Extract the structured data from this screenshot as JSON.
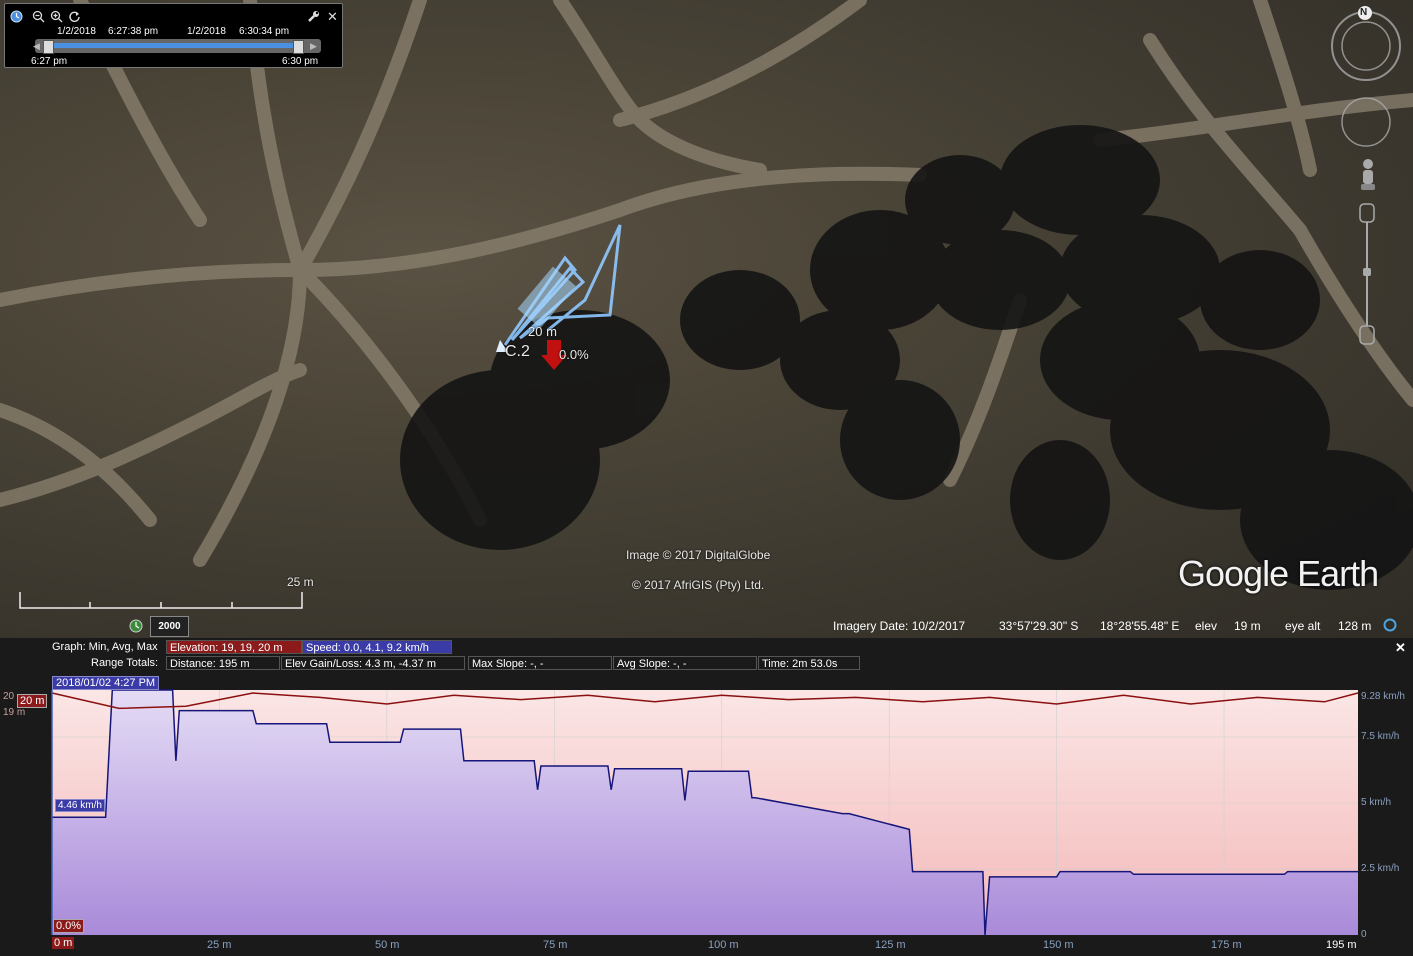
{
  "time_slider": {
    "start_date": "1/2/2018",
    "start_time": "6:27:38 pm",
    "end_date": "1/2/2018",
    "end_time": "6:30:34 pm",
    "left_label": "6:27 pm",
    "right_label": "6:30 pm",
    "close_glyph": "✕"
  },
  "map": {
    "scale_label": "25 m",
    "year_badge": "2000",
    "track_label_distance": "20 m",
    "track_label_name": "C.2",
    "track_label_grade": "0.0%",
    "copyright_image": "Image © 2017 DigitalGlobe",
    "copyright_afrigis": "© 2017 AfriGIS (Pty) Ltd.",
    "logo": "Google Earth",
    "north": "N"
  },
  "status_bar": {
    "imagery_date": "Imagery Date: 10/2/2017",
    "latitude": "33°57'29.30\" S",
    "longitude": "18°28'55.48\" E",
    "elev_label": "elev",
    "elev_value": "19 m",
    "eye_alt_label": "eye alt",
    "eye_alt_value": "128 m"
  },
  "profile": {
    "graph_label": "Graph: Min, Avg, Max",
    "range_label": "Range Totals:",
    "elevation_summary": "Elevation: 19, 19, 20 m",
    "speed_summary": "Speed: 0.0, 4.1, 9.2 km/h",
    "distance": "Distance: 195 m",
    "elev_gain_loss": "Elev Gain/Loss: 4.3 m, -4.37 m",
    "max_slope": "Max Slope: -, -",
    "avg_slope": "Avg Slope: -, -",
    "time": "Time: 2m 53.0s",
    "close_glyph": "✕",
    "cursor_time": "2018/01/02 4:27 PM",
    "cursor_elev": "20 m",
    "cursor_speed": "4.46 km/h",
    "cursor_grade": "0.0%",
    "cursor_distance": "0 m",
    "left_axis": [
      "20",
      "19 m"
    ],
    "right_axis": [
      "9.28 km/h",
      "7.5 km/h",
      "5 km/h",
      "2.5 km/h",
      "0"
    ],
    "x_ticks": [
      "25 m",
      "50 m",
      "75 m",
      "100 m",
      "125 m",
      "150 m",
      "175 m",
      "195 m"
    ]
  },
  "chart_data": {
    "type": "line",
    "xlabel": "",
    "ylabel": "",
    "xlim": [
      0,
      195
    ],
    "series": [
      {
        "x": [
          0,
          8,
          9,
          18,
          18.5,
          19,
          30,
          30.5,
          41,
          41.5,
          52,
          52.5,
          61,
          61.5,
          72,
          72.5,
          73,
          83,
          83.5,
          84,
          94,
          94.5,
          95,
          104,
          104.5,
          105,
          118,
          119,
          128,
          128.5,
          139,
          139.3,
          140,
          150,
          150.5,
          161,
          161.5,
          174,
          174.5,
          184,
          184.5,
          195
        ],
        "values": [
          4.46,
          4.46,
          9.28,
          9.28,
          6.6,
          8.5,
          8.5,
          8.0,
          8.0,
          7.3,
          7.3,
          7.8,
          7.8,
          6.6,
          6.6,
          5.5,
          6.4,
          6.4,
          5.5,
          6.3,
          6.3,
          5.1,
          6.2,
          6.2,
          5.2,
          5.2,
          4.6,
          4.6,
          4.0,
          2.4,
          2.4,
          0,
          2.2,
          2.2,
          2.4,
          2.4,
          2.3,
          2.3,
          2.3,
          2.3,
          2.4,
          2.4
        ]
      },
      {
        "x": [
          0,
          10,
          20,
          30,
          40,
          50,
          60,
          70,
          80,
          90,
          100,
          110,
          120,
          130,
          140,
          150,
          160,
          170,
          180,
          190,
          195
        ],
        "values": [
          20,
          19.3,
          19.4,
          20,
          19.8,
          19.5,
          19.9,
          19.7,
          19.9,
          19.6,
          19.9,
          19.7,
          19.8,
          19.6,
          19.8,
          19.5,
          19.9,
          19.5,
          19.8,
          19.6,
          20
        ]
      }
    ]
  }
}
